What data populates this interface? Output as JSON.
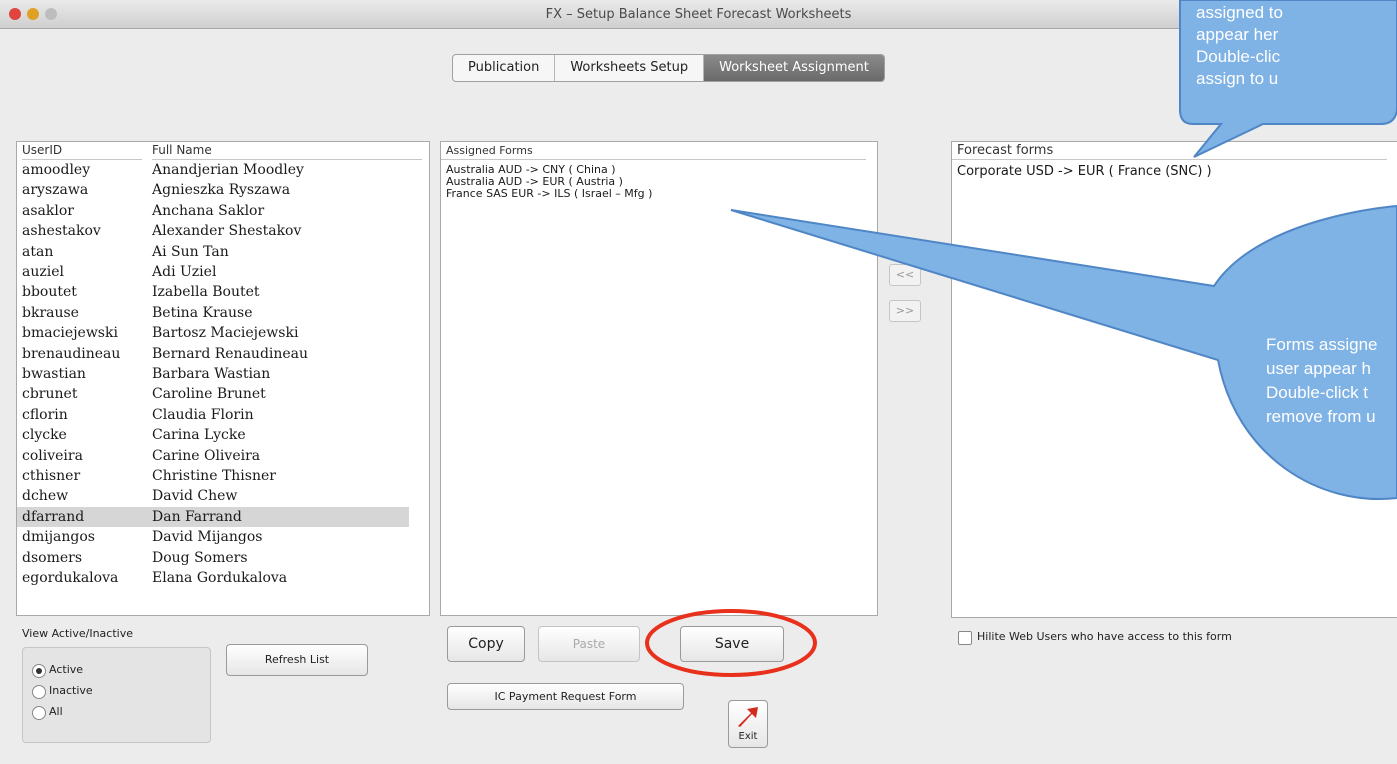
{
  "window": {
    "title": "FX – Setup Balance Sheet Forecast Worksheets"
  },
  "tabs": [
    {
      "label": "Publication",
      "active": false
    },
    {
      "label": "Worksheets Setup",
      "active": false
    },
    {
      "label": "Worksheet Assignment",
      "active": true
    }
  ],
  "users": {
    "headers": {
      "id": "UserID",
      "name": "Full Name"
    },
    "selected_id": "dfarrand",
    "rows": [
      {
        "id": "amoodley",
        "name": "Anandjerian Moodley"
      },
      {
        "id": "aryszawa",
        "name": "Agnieszka Ryszawa"
      },
      {
        "id": "asaklor",
        "name": "Anchana Saklor"
      },
      {
        "id": "ashestakov",
        "name": "Alexander Shestakov"
      },
      {
        "id": "atan",
        "name": "Ai Sun Tan"
      },
      {
        "id": "auziel",
        "name": "Adi Uziel"
      },
      {
        "id": "bboutet",
        "name": "Izabella Boutet"
      },
      {
        "id": "bkrause",
        "name": "Betina Krause"
      },
      {
        "id": "bmaciejewski",
        "name": "Bartosz Maciejewski"
      },
      {
        "id": "brenaudineau",
        "name": "Bernard Renaudineau"
      },
      {
        "id": "bwastian",
        "name": "Barbara Wastian"
      },
      {
        "id": "cbrunet",
        "name": "Caroline Brunet"
      },
      {
        "id": "cflorin",
        "name": "Claudia Florin"
      },
      {
        "id": "clycke",
        "name": "Carina Lycke"
      },
      {
        "id": "coliveira",
        "name": "Carine Oliveira"
      },
      {
        "id": "cthisner",
        "name": "Christine Thisner"
      },
      {
        "id": "dchew",
        "name": "David Chew"
      },
      {
        "id": "dfarrand",
        "name": "Dan Farrand"
      },
      {
        "id": "dmijangos",
        "name": "David Mijangos"
      },
      {
        "id": "dsomers",
        "name": "Doug Somers"
      },
      {
        "id": "egordukalova",
        "name": "Elana Gordukalova"
      }
    ]
  },
  "assigned": {
    "header": "Assigned Forms",
    "rows": [
      "Australia AUD -> CNY ( China )",
      "Australia AUD -> EUR ( Austria )",
      "France SAS EUR -> ILS ( Israel – Mfg )"
    ]
  },
  "forecast": {
    "header": "Forecast forms",
    "rows": [
      "Corporate USD -> EUR ( France (SNC) )"
    ]
  },
  "buttons": {
    "move_left": "<<",
    "move_right": ">>",
    "copy": "Copy",
    "paste": "Paste",
    "save": "Save",
    "ic_payment": "IC Payment Request Form",
    "refresh": "Refresh List",
    "exit": "Exit"
  },
  "view_filter": {
    "label": "View Active/Inactive",
    "selected": "Active",
    "options": [
      "Active",
      "Inactive",
      "All"
    ]
  },
  "hilite": {
    "label": "Hilite Web Users who have access to this form",
    "checked": false
  },
  "callouts": {
    "top": [
      "assigned to",
      "appear her",
      "Double-clic",
      "assign to u"
    ],
    "middle": [
      "Forms assigne",
      "user appear h",
      "Double-click t",
      "remove from u"
    ]
  },
  "colors": {
    "callout_fill": "#7fb2e5",
    "callout_stroke": "#4f86c6",
    "highlight_circle": "#e8311d",
    "tab_active": "#7a7a7a",
    "exit_arrow": "#d42a1e"
  },
  "icons": {
    "exit": "red-diagonal-arrow-icon"
  }
}
